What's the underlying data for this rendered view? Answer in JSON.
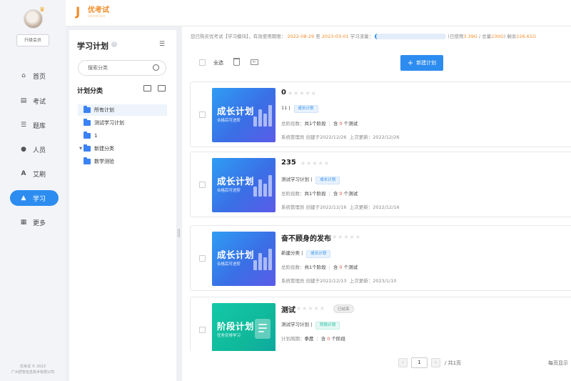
{
  "nav": {
    "upgrade_label": "升级会员",
    "items": [
      {
        "label": "首页",
        "icon": "home-icon"
      },
      {
        "label": "考试",
        "icon": "exam-icon"
      },
      {
        "label": "题库",
        "icon": "question-bank-icon"
      },
      {
        "label": "人员",
        "icon": "user-icon"
      },
      {
        "label": "艾刷",
        "icon": "letter-a-icon"
      },
      {
        "label": "学习",
        "icon": "graduation-cap-icon"
      },
      {
        "label": "更多",
        "icon": "grid-icon"
      }
    ],
    "active_index": 5,
    "copyright_line1": "优考试 © 2023",
    "copyright_line2": "广州舒智信息技术有限公司"
  },
  "brand": {
    "name": "优考试",
    "sub": "UKAOSHI"
  },
  "category_panel": {
    "title": "学习计划",
    "search_placeholder": "搜索分类",
    "section_title": "计划分类",
    "tree": [
      {
        "label": "所有计划",
        "level": 0,
        "selected": true
      },
      {
        "label": "测试学习计划",
        "level": 0
      },
      {
        "label": "1",
        "level": 0
      },
      {
        "label": "新建分类",
        "level": 0,
        "expanded": true
      },
      {
        "label": "数学测验",
        "level": 1
      }
    ]
  },
  "notice": {
    "prefix": "您已购买优考试【学习模块】，有效使用期限：",
    "start": "2022-08-29",
    "to": "至",
    "end": "2023-03-01",
    "flow_label": "学习流量：",
    "used_prefix": "(已使用",
    "used": "3.39G",
    "total_prefix": "/ 总量",
    "total": "230G",
    "remain_prefix": ") 剩余",
    "remain": "226.61G"
  },
  "toolbar": {
    "select_all": "全选",
    "new_plan": "新建计划"
  },
  "plans": [
    {
      "name": "0",
      "cover_title": "成长计划",
      "cover_sub": "合格后可进阶",
      "cover_style": "blue",
      "category": "11",
      "tag": "成长计划",
      "stats_label1": "总阶段数：",
      "stats_value1": "共1个阶段",
      "stats_label2": "含",
      "stats_count": "0",
      "stats_label3": "个测试",
      "creator": "系统管理员",
      "created": "创建于2022/12/26",
      "updated": "上次更新：2022/12/26"
    },
    {
      "name": "235",
      "cover_title": "成长计划",
      "cover_sub": "合格后可进阶",
      "cover_style": "blue",
      "category": "测试学习计划",
      "tag": "成长计划",
      "stats_label1": "总阶段数：",
      "stats_value1": "共1个阶段",
      "stats_label2": "含",
      "stats_count": "0",
      "stats_label3": "个测试",
      "creator": "系统管理员",
      "created": "创建于2022/12/16",
      "updated": "上次更新：2022/12/16"
    },
    {
      "name": "奋不顾身的发布",
      "cover_title": "成长计划",
      "cover_sub": "合格后可进阶",
      "cover_style": "blue",
      "category": "新建分类",
      "tag": "成长计划",
      "stats_label1": "总阶段数：",
      "stats_value1": "共1个阶段",
      "stats_label2": "含",
      "stats_count": "0",
      "stats_label3": "个测试",
      "creator": "系统管理员",
      "created": "创建于2022/12/13",
      "updated": "上次更新：2023/1/10"
    },
    {
      "name": "测试",
      "cover_title": "阶段计划",
      "cover_sub": "任务安排学习",
      "cover_style": "teal",
      "status": "已结束",
      "category": "测试学习计划",
      "tag": "阶段计划",
      "stats_label1": "计划周期：",
      "stats_value1": "季度",
      "stats_label2": "含",
      "stats_count": "0",
      "stats_label3": "个阶段",
      "creator": "",
      "created": "",
      "updated": ""
    }
  ],
  "pagination": {
    "current": "1",
    "total": "/ 共1页",
    "per_page": "每页显示"
  }
}
